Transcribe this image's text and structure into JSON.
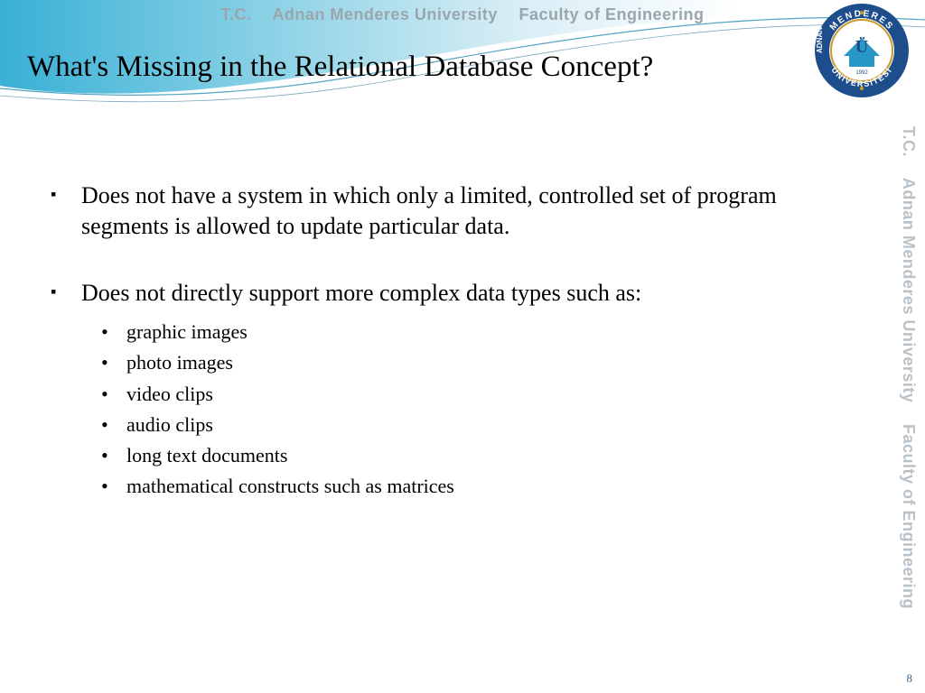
{
  "header": {
    "tc": "T.C.",
    "uni": "Adnan Menderes University",
    "fac": "Faculty of Engineering"
  },
  "side": {
    "tc": "T.C.",
    "uni": "Adnan Menderes University",
    "fac": "Faculty of Engineering"
  },
  "logo": {
    "top": "MENDERES",
    "left": "ADNAN",
    "bottom": "ÜNİVERSİTESİ",
    "year": "1992",
    "letter": "Ü"
  },
  "title": "What's Missing in the Relational Database Concept?",
  "bullets": [
    {
      "text": "Does not have a system in which only a limited, controlled set of program segments is allowed to update particular data."
    },
    {
      "text": "Does not directly support more complex data types such as:",
      "sub": [
        "graphic images",
        "photo images",
        "video clips",
        "audio clips",
        "long text documents",
        "mathematical constructs such as matrices"
      ]
    }
  ],
  "page_number": "8"
}
